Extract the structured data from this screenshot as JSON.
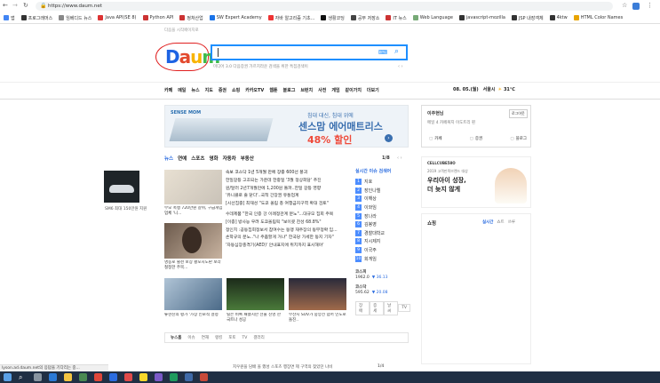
{
  "browser": {
    "url": "https://www.daum.net",
    "bookmarks": [
      {
        "label": "앱",
        "color": "#4285f4"
      },
      {
        "label": "프로그래머스",
        "color": "#333"
      },
      {
        "label": "임베디드 뉴스",
        "color": "#888"
      },
      {
        "label": "Java API(SE 8)",
        "color": "#d33"
      },
      {
        "label": "Python API",
        "color": "#c33"
      },
      {
        "label": "정처산업",
        "color": "#c33"
      },
      {
        "label": "SW Expert Academy",
        "color": "#1a73e8"
      },
      {
        "label": "자바 알고리즘 기초...",
        "color": "#e33"
      },
      {
        "label": "생활코딩",
        "color": "#111"
      },
      {
        "label": "공부 저장소",
        "color": "#444"
      },
      {
        "label": "IT 뉴스",
        "color": "#c33"
      },
      {
        "label": "Web Language",
        "color": "#7a7"
      },
      {
        "label": "javascript-mozilla",
        "color": "#333"
      },
      {
        "label": "JSP 내장객체",
        "color": "#333"
      },
      {
        "label": "4ktw",
        "color": "#333"
      },
      {
        "label": "HTML Color Names",
        "color": "#e8a400"
      }
    ]
  },
  "page": {
    "top_link": "다음을 시작페이지로",
    "logo": "Daum",
    "search_hint": "미디어 3.0 다음증권 가르치라운 검색을 위한 특집검색이",
    "nav": [
      "카페",
      "메일",
      "뉴스",
      "지도",
      "증권",
      "쇼핑",
      "카카오TV",
      "웹툰",
      "블로그",
      "브런치",
      "사전",
      "게임",
      "같이가치",
      "더보기"
    ],
    "date": "08. 05.(월)",
    "weather": "서울시",
    "temp": "31℃",
    "banner": {
      "brand": "SENSE MOM",
      "line1": "침대 대신, 침대 위에",
      "line2": "센스맘 에어매트리스",
      "line3": "48% 할인"
    },
    "news_tabs": [
      "뉴스",
      "연예",
      "스포츠",
      "영화",
      "자동차",
      "부동산"
    ],
    "news_page": "1/8",
    "side_caption": "SM6 최대 150만원 지원",
    "thumb_captions": [
      "부모 폭행 720만원 갈취, 구급개입업체 '니...",
      "명동로 쥘천 보상 황포시도판 보라철정한 주목..."
    ],
    "headlines": [
      "속보 코스닥 1년 5개월 만에 장중 600선 붕괴",
      "한일갈등 고조되는 가운데 한중일 '3월 정상회담' 추진",
      "원/달러 2년7개월만에 1,200원 돌파..한일 갈등 영향",
      "'유니클로 줄 닫다'..국적 간장권 유통업계",
      "[시선집중] 최재성 \"도쿄 올림 총 여행금지구역 확대 검토\"",
      "수데제품 \"한국 인증 강 이례정관계 분노\"...대규모 집회 주목",
      "[이종] 방사능 우려 도쿄올림픽 \"보이콧 찬성 68.8%\"",
      "정인치 :공동집회정보서 참여수는 동맹 재주장의 동무정확 임...",
      "손학규의 분노..\"나 주춤할게 거냐\" 한국당 가세한 동지 기자\"",
      "'자동심장충격기(AED)' 안내표지에 위치까지 표시해야'"
    ],
    "bottom_captions": [
      "류현진의 평가 '가장 인로적 결정",
      "릴은 비록 패했지만 선물 진영 한국트나 성공",
      "부산시 SUV가 중앙선 넘어 인도로 돌진.."
    ],
    "bottom_news": [
      "뉴스홈",
      "이슈",
      "연재",
      "랭킹",
      "포토",
      "TV",
      "갤러리"
    ],
    "ticker_text": "지우원을 담배 올 했성 스포츠 행장면 제 구역의 찾았던 나비",
    "ticker_page": "1/4",
    "issue_title": "실시간 이슈 검색어",
    "issues": [
      "지호",
      "장인나엘",
      "이해상",
      "이와임",
      "장나라",
      "김봉영",
      "경찰대학교",
      "지시제지",
      "이국주",
      "회게임"
    ],
    "stocks": [
      {
        "name": "코스피",
        "value": "1962.0",
        "change": "▼ 36.13"
      },
      {
        "name": "코스닥",
        "value": "595.62",
        "change": "▼ 20.08"
      }
    ],
    "issue_tabs": [
      "장애",
      "증세",
      "날씨",
      "TV"
    ],
    "login": {
      "title": "이주현님",
      "sub": "메일 4  카페복지  이도트리 핀",
      "btn": "로그아웃",
      "items": [
        "카페",
        "증권",
        "블로그"
      ]
    },
    "ad": {
      "brand": "CELLCUBE58O",
      "small": "2019 고객만족브랜드 대상",
      "line1": "우리아이 성장,",
      "line2": "더 늦지 않게"
    },
    "shopping": {
      "title": "쇼핑",
      "tabs": [
        "실시간",
        "쇼트",
        "쓰루"
      ]
    },
    "status": "lyson.ad.daum.net의 응답을 기다리는 중..."
  }
}
